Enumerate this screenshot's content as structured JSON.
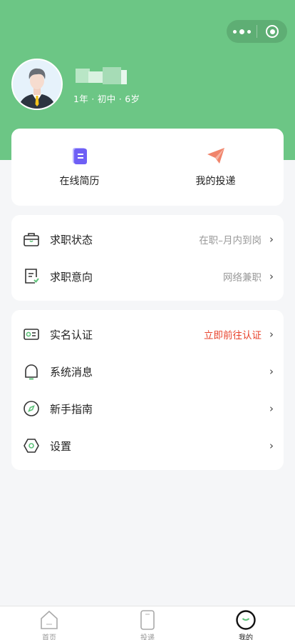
{
  "header": {
    "bg_color": "#6cc685",
    "user_meta": "1年 · 初中 · 6岁"
  },
  "quick_actions": [
    {
      "label": "在线简历",
      "icon": "resume-icon"
    },
    {
      "label": "我的投递",
      "icon": "paper-plane-icon"
    }
  ],
  "job_section": [
    {
      "label": "求职状态",
      "value": "在职–月内到岗",
      "icon": "briefcase-icon"
    },
    {
      "label": "求职意向",
      "value": "网络兼职",
      "icon": "intention-icon"
    }
  ],
  "settings_section": [
    {
      "label": "实名认证",
      "value": "立即前往认证",
      "value_color": "#e8432c",
      "icon": "id-card-icon"
    },
    {
      "label": "系统消息",
      "value": "",
      "icon": "bell-icon"
    },
    {
      "label": "新手指南",
      "value": "",
      "icon": "compass-icon"
    },
    {
      "label": "设置",
      "value": "",
      "icon": "settings-icon"
    }
  ],
  "chevron": "›",
  "tabbar": [
    {
      "label": "首页",
      "icon": "home-icon",
      "active": false
    },
    {
      "label": "投递",
      "icon": "delivery-icon",
      "active": false
    },
    {
      "label": "我的",
      "icon": "profile-icon",
      "active": true
    }
  ]
}
